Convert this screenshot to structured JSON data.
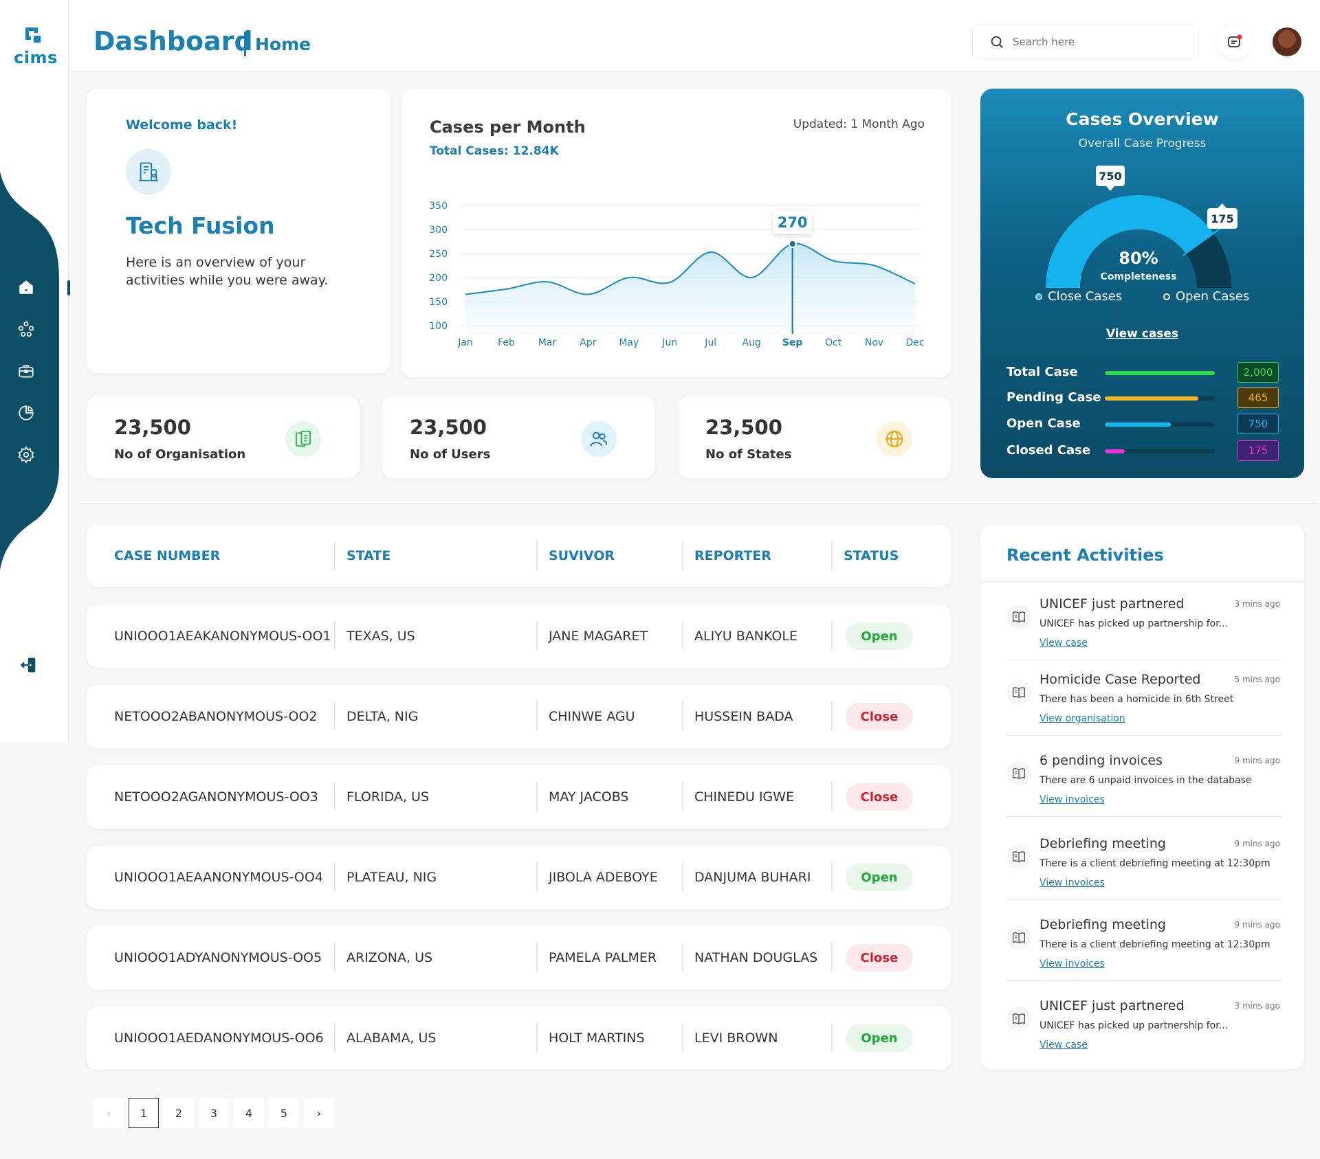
{
  "brand": {
    "logo_text": "cims"
  },
  "header": {
    "title": "Dashboard",
    "breadcrumb": "Home",
    "search_placeholder": "Search here"
  },
  "sidebar": {
    "items": [
      {
        "name": "home",
        "icon": "home-icon"
      },
      {
        "name": "groups",
        "icon": "people-network-icon"
      },
      {
        "name": "cases",
        "icon": "briefcase-icon"
      },
      {
        "name": "reports",
        "icon": "pie-chart-icon"
      },
      {
        "name": "settings",
        "icon": "gear-icon"
      }
    ],
    "logout_icon": "logout-icon"
  },
  "welcome": {
    "greeting": "Welcome back!",
    "name": "Tech Fusion",
    "message": "Here is an overview of your activities while you were away."
  },
  "cases_chart": {
    "title": "Cases per Month",
    "total": "Total Cases: 12.84K",
    "updated": "Updated: 1 Month Ago"
  },
  "chart_data": {
    "type": "area",
    "categories": [
      "Jan",
      "Feb",
      "Mar",
      "Apr",
      "May",
      "Jun",
      "Jul",
      "Aug",
      "Sep",
      "Oct",
      "Nov",
      "Dec"
    ],
    "values": [
      165,
      176,
      191,
      165,
      200,
      190,
      253,
      200,
      270,
      235,
      225,
      187
    ],
    "highlight": {
      "category": "Sep",
      "value": 270,
      "label": "270"
    },
    "yticks": [
      100,
      150,
      200,
      250,
      300,
      350
    ],
    "ylim": [
      100,
      350
    ],
    "grid": true,
    "colors": {
      "line": "#1a8ab8",
      "fill": "#e3f3fb",
      "grid": "#d8e8f2",
      "axis": "#1c7fb1"
    }
  },
  "stats": [
    {
      "value": "23,500",
      "label": "No of Organisation",
      "icon": "documents-icon",
      "bg": "#e5f7ea",
      "color": "#2fb157"
    },
    {
      "value": "23,500",
      "label": "No of Users",
      "icon": "users-icon",
      "bg": "#e0f2fb",
      "color": "#1c7fb1"
    },
    {
      "value": "23,500",
      "label": "No of States",
      "icon": "globe-icon",
      "bg": "#fff3dc",
      "color": "#f2a516"
    }
  ],
  "overview": {
    "title": "Cases Overview",
    "subtitle": "Overall Case Progress",
    "percent_text": "80%",
    "percent_label": "Completeness",
    "close_value": "750",
    "open_value": "175",
    "progress": 0.8,
    "legend_close": "Close Cases",
    "legend_open": "Open Cases",
    "view_link": "View cases",
    "colors": {
      "close": "#16b2f0",
      "open": "#0b3b50"
    },
    "rows": [
      {
        "label": "Total Case",
        "value": "2,000",
        "fraction": 1.0,
        "color": "#2bd94c",
        "border": "#2bd94c",
        "bg": "#0e4a2a"
      },
      {
        "label": "Pending Case",
        "value": "465",
        "fraction": 0.85,
        "color": "#f3b51d",
        "border": "#f3b51d",
        "bg": "#4a3a0c"
      },
      {
        "label": "Open Case",
        "value": "750",
        "fraction": 0.6,
        "color": "#19b7f2",
        "border": "#19b7f2",
        "bg": "#0d3a55"
      },
      {
        "label": "Closed Case",
        "value": "175",
        "fraction": 0.18,
        "color": "#ef2fd7",
        "border": "#ef2fd7",
        "bg": "#3d2470"
      }
    ]
  },
  "table": {
    "headers": [
      "CASE NUMBER",
      "STATE",
      "SUVIVOR",
      "REPORTER",
      "STATUS"
    ],
    "rows": [
      {
        "case": "UNIOOO1AEAKANONYMOUS-OO1",
        "state": "TEXAS, US",
        "survivor": "JANE MAGARET",
        "reporter": "ALIYU BANKOLE",
        "status": "Open"
      },
      {
        "case": "NETOOO2ABANONYMOUS-OO2",
        "state": "DELTA, NIG",
        "survivor": "CHINWE AGU",
        "reporter": "HUSSEIN BADA",
        "status": "Close"
      },
      {
        "case": "NETOOO2AGANONYMOUS-OO3",
        "state": "FLORIDA, US",
        "survivor": "MAY JACOBS",
        "reporter": "CHINEDU IGWE",
        "status": "Close"
      },
      {
        "case": "UNIOOO1AEAANONYMOUS-OO4",
        "state": "PLATEAU, NIG",
        "survivor": "JIBOLA ADEBOYE",
        "reporter": "DANJUMA BUHARI",
        "status": "Open"
      },
      {
        "case": "UNIOOO1ADYANONYMOUS-OO5",
        "state": "ARIZONA, US",
        "survivor": "PAMELA PALMER",
        "reporter": "NATHAN DOUGLAS",
        "status": "Close"
      },
      {
        "case": "UNIOOO1AEDANONYMOUS-OO6",
        "state": "ALABAMA, US",
        "survivor": "HOLT MARTINS",
        "reporter": "LEVI BROWN",
        "status": "Open"
      }
    ]
  },
  "pagination": {
    "prev": "‹",
    "next": "›",
    "pages": [
      "1",
      "2",
      "3",
      "4",
      "5"
    ],
    "current": "1"
  },
  "activities": {
    "title": "Recent Activities",
    "items": [
      {
        "title": "UNICEF just partnered",
        "time": "3 mins ago",
        "desc": "UNICEF has picked up partnership for...",
        "link": "View case"
      },
      {
        "title": "Homicide Case Reported",
        "time": "5 mins ago",
        "desc": "There has been a homicide in 6th Street",
        "link": "View organisation"
      },
      {
        "title": "6 pending invoices",
        "time": "9 mins ago",
        "desc": "There are 6 unpaid invoices in the database",
        "link": "View invoices"
      },
      {
        "title": "Debriefing meeting",
        "time": "9 mins ago",
        "desc": "There is a client debriefing meeting at 12:30pm",
        "link": "View invoices"
      },
      {
        "title": "Debriefing meeting",
        "time": "9 mins ago",
        "desc": "There is a client debriefing meeting at 12:30pm",
        "link": "View invoices"
      },
      {
        "title": "UNICEF just partnered",
        "time": "3 mins ago",
        "desc": "UNICEF has picked up partnership for...",
        "link": "View case"
      }
    ]
  }
}
